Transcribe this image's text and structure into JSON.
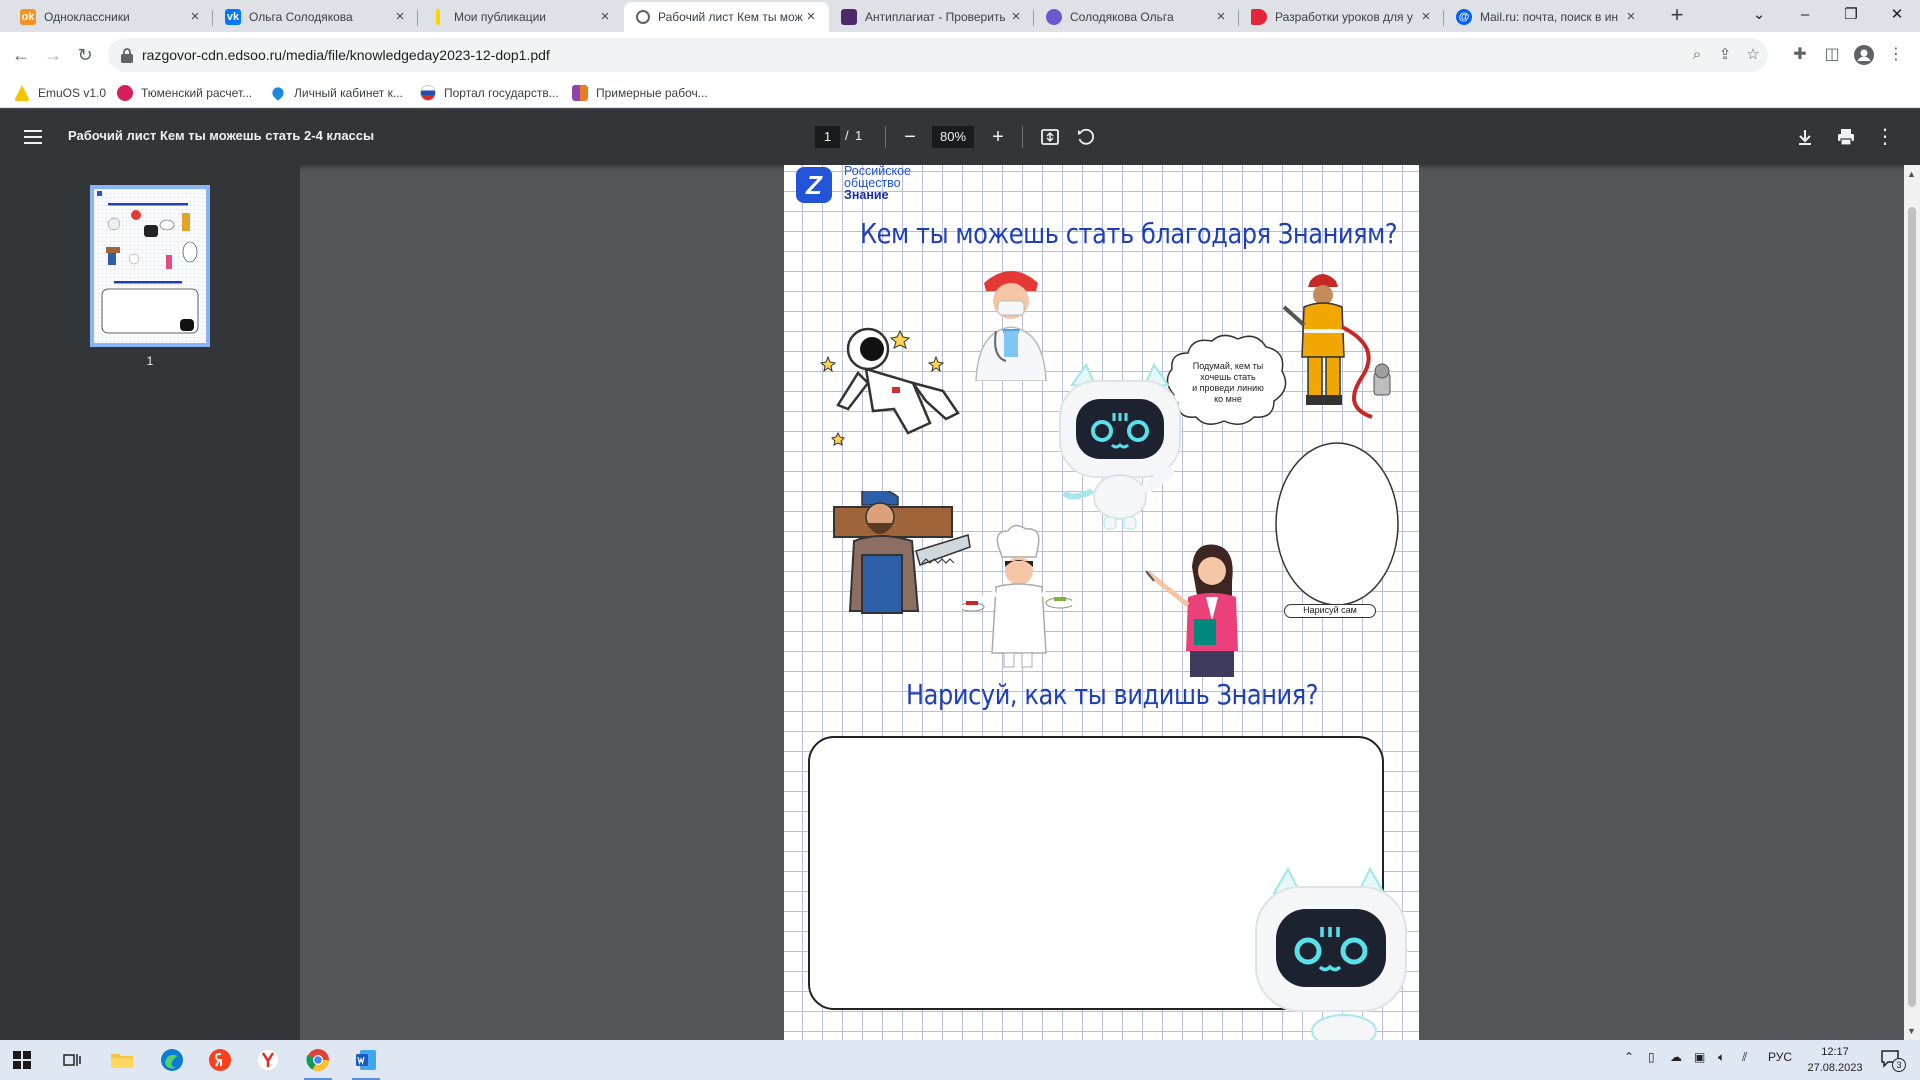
{
  "tabs": [
    {
      "title": "Одноклассники",
      "icon": "odnoklassniki-icon",
      "color": "#f7931e",
      "glyph": "ok"
    },
    {
      "title": "Ольга Солодякова",
      "icon": "vk-icon",
      "color": "#0077ff",
      "glyph": "vk"
    },
    {
      "title": "Мои публикации",
      "icon": "yandex-zen-icon",
      "color": "#ffd400",
      "glyph": ""
    },
    {
      "title": "Рабочий лист Кем ты мож",
      "icon": "globe-icon",
      "color": "#5f6368",
      "glyph": ""
    },
    {
      "title": "Антиплагиат - Проверить",
      "icon": "antiplagiat-icon",
      "color": "#4b2a68",
      "glyph": ""
    },
    {
      "title": "Солодякова Ольга",
      "icon": "vk-edu-icon",
      "color": "#6a5acd",
      "glyph": ""
    },
    {
      "title": "Разработки уроков для у",
      "icon": "infourok-icon",
      "color": "#e32636",
      "glyph": ""
    },
    {
      "title": "Mail.ru: почта, поиск в ин",
      "icon": "mailru-icon",
      "color": "#005ff9",
      "glyph": "@"
    }
  ],
  "address": {
    "url": "razgovor-cdn.edsoo.ru/media/file/knowledgeday2023-12-dop1.pdf"
  },
  "bookmarks": [
    {
      "label": "EmuOS v1.0",
      "icon": "emuos-icon",
      "color": "#f5c400"
    },
    {
      "label": "Тюменский расчет...",
      "icon": "tyumen-icon",
      "color": "#d81e5b"
    },
    {
      "label": "Личный кабинет к...",
      "icon": "drop-icon",
      "color": "#1e88e5"
    },
    {
      "label": "Портал государств...",
      "icon": "russia-flag-icon",
      "color": "#1e4fb5"
    },
    {
      "label": "Примерные рабоч...",
      "icon": "doc-grid-icon",
      "color": "#8e44ad"
    }
  ],
  "pdf": {
    "title": "Рабочий лист Кем ты можешь стать 2-4 классы",
    "page": "1",
    "page_sep": "/",
    "page_total": "1",
    "zoom": "80%",
    "thumb_number": "1"
  },
  "worksheet": {
    "org_line1": "Российское",
    "org_line2": "общество",
    "org_line3": "Знание",
    "logo_letter": "Z",
    "heading": "Кем ты можешь стать благодаря Знаниям?",
    "bubble_line1": "Подумай, кем ты",
    "bubble_line2": "хочешь стать",
    "bubble_line3": "и проведи линию",
    "bubble_line4": "ко мне",
    "oval_label": "Нарисуй сам",
    "draw_heading": "Нарисуй, как ты видишь Знания?"
  },
  "taskbar": {
    "apps": [
      {
        "name": "task-view-icon"
      },
      {
        "name": "file-explorer-icon"
      },
      {
        "name": "edge-icon"
      },
      {
        "name": "yandex-icon"
      },
      {
        "name": "yandex-browser-icon"
      },
      {
        "name": "chrome-icon"
      },
      {
        "name": "word-icon"
      }
    ],
    "language": "РУС",
    "time": "12:17",
    "date": "27.08.2023",
    "notifications": "3"
  }
}
